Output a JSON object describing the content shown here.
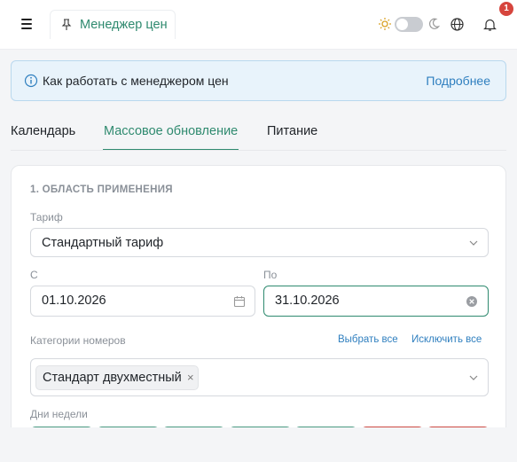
{
  "header": {
    "tab_title": "Менеджер цен",
    "notification_count": "1",
    "icons": [
      "menu-icon",
      "pin-icon",
      "sun-icon",
      "moon-icon",
      "globe-icon",
      "bell-icon"
    ]
  },
  "banner": {
    "text": "Как работать с менеджером цен",
    "link": "Подробнее"
  },
  "tabs": [
    {
      "label": "Календарь",
      "active": false
    },
    {
      "label": "Массовое обновление",
      "active": true
    },
    {
      "label": "Питание",
      "active": false
    }
  ],
  "section": {
    "title": "1. ОБЛАСТЬ ПРИМЕНЕНИЯ",
    "tariff_label": "Тариф",
    "tariff_value": "Стандартный тариф",
    "from_label": "С",
    "from_value": "01.10.2026",
    "to_label": "По",
    "to_value": "31.10.2026",
    "categories_label": "Категории номеров",
    "select_all": "Выбрать все",
    "exclude_all": "Исключить все",
    "selected_categories": [
      "Стандарт двухместный"
    ],
    "weekdays_label": "Дни недели",
    "weekday_buttons": [
      {
        "state": "on",
        "color": "#4a9a82"
      },
      {
        "state": "on",
        "color": "#4a9a82"
      },
      {
        "state": "on",
        "color": "#4a9a82"
      },
      {
        "state": "on",
        "color": "#4a9a82"
      },
      {
        "state": "on",
        "color": "#4a9a82"
      },
      {
        "state": "weekend",
        "color": "#cc4a44"
      },
      {
        "state": "weekend",
        "color": "#cc4a44"
      }
    ]
  },
  "colors": {
    "accent": "#2f8a6f",
    "link": "#2f7fbf",
    "banner_bg": "#e8f3fb",
    "badge": "#d6453d"
  }
}
